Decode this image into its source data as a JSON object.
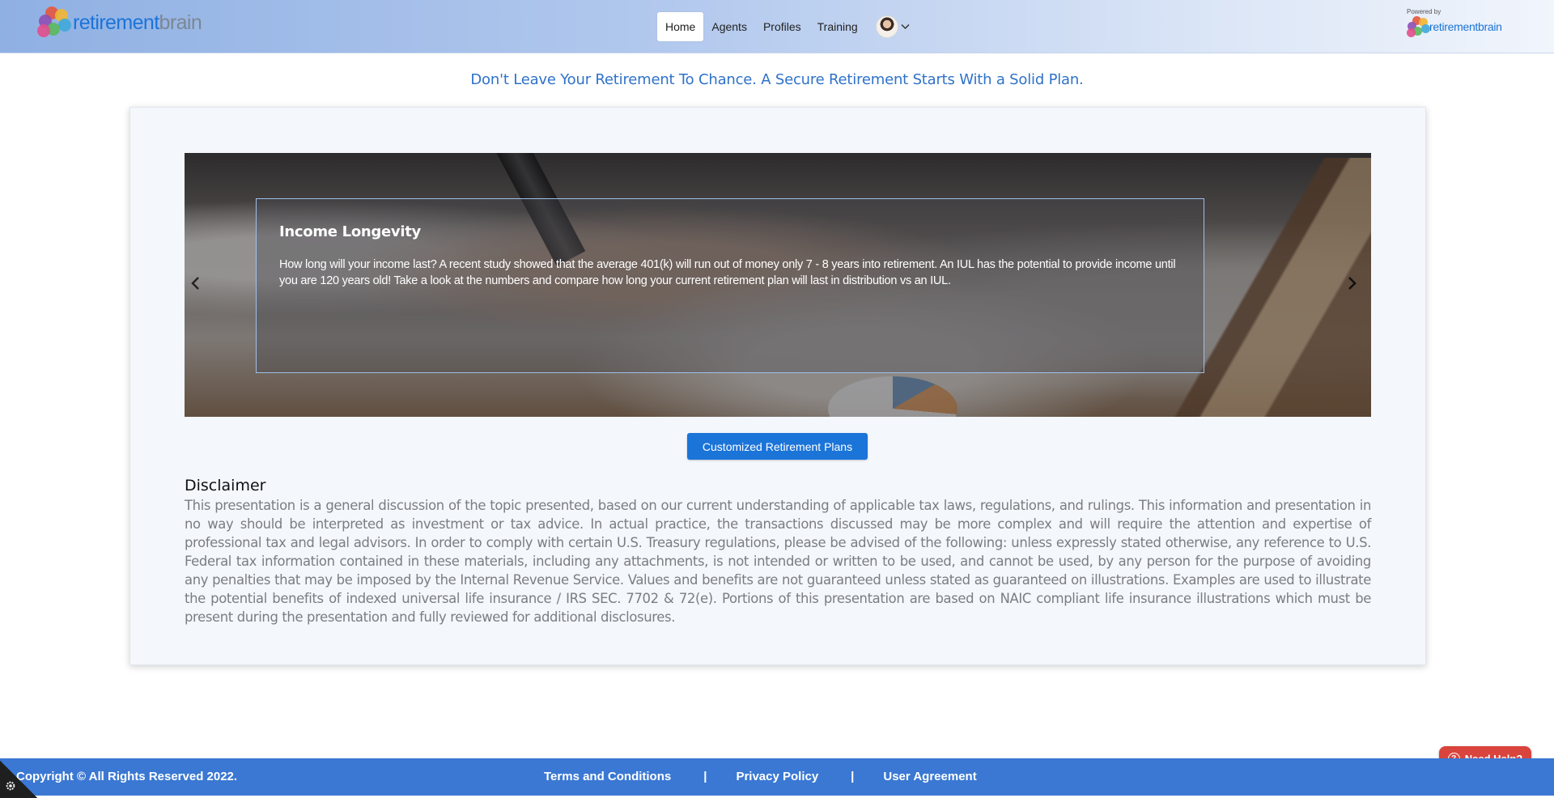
{
  "header": {
    "brand": {
      "part1": "retirement",
      "part2": "brain"
    },
    "nav": [
      {
        "label": "Home",
        "active": true
      },
      {
        "label": "Agents"
      },
      {
        "label": "Profiles"
      },
      {
        "label": "Training"
      }
    ],
    "powered_by": {
      "label": "Powered by",
      "part1": "retirement",
      "part2": "brain"
    }
  },
  "tagline": "Don't Leave Your Retirement To Chance. A Secure Retirement Starts With a Solid Plan.",
  "carousel": {
    "slide_title": "Income Longevity",
    "slide_text": "How long will your income last? A recent study showed that the average 401(k) will run out of money only 7 - 8 years into retirement. An IUL has the potential to provide income until you are 120 years old! Take a look at the numbers and compare how long your current retirement plan will last in distribution vs an IUL.",
    "prev_icon": "chevron-left-icon",
    "next_icon": "chevron-right-icon"
  },
  "cta_label": "Customized Retirement Plans",
  "disclaimer": {
    "title": "Disclaimer",
    "text": "This presentation is a general discussion of the topic presented, based on our current understanding of applicable tax laws, regulations, and rulings. This information and presentation in no way should be interpreted as investment or tax advice. In actual practice, the transactions discussed may be more complex and will require the attention and expertise of professional tax and legal advisors. In order to comply with certain U.S. Treasury regulations, please be advised of the following: unless expressly stated otherwise, any reference to U.S. Federal tax information contained in these materials, including any attachments, is not intended or written to be used, and cannot be used, by any person for the purpose of avoiding any penalties that may be imposed by the Internal Revenue Service. Values and benefits are not guaranteed unless stated as guaranteed on illustrations. Examples are used to illustrate the potential benefits of indexed universal life insurance / IRS SEC. 7702 & 72(e). Portions of this presentation are based on NAIC compliant life insurance illustrations which must be present during the presentation and fully reviewed for additional disclosures."
  },
  "footer": {
    "copyright": "Copyright © All Rights Reserved 2022.",
    "links": [
      "Terms and Conditions",
      "Privacy Policy",
      "User Agreement"
    ],
    "separator": "|"
  },
  "help_label": "Need Help?",
  "colors": {
    "accent": "#1b74d8",
    "footer": "#3a78d3",
    "help": "#d9443c",
    "tagline": "#2f72c9"
  }
}
